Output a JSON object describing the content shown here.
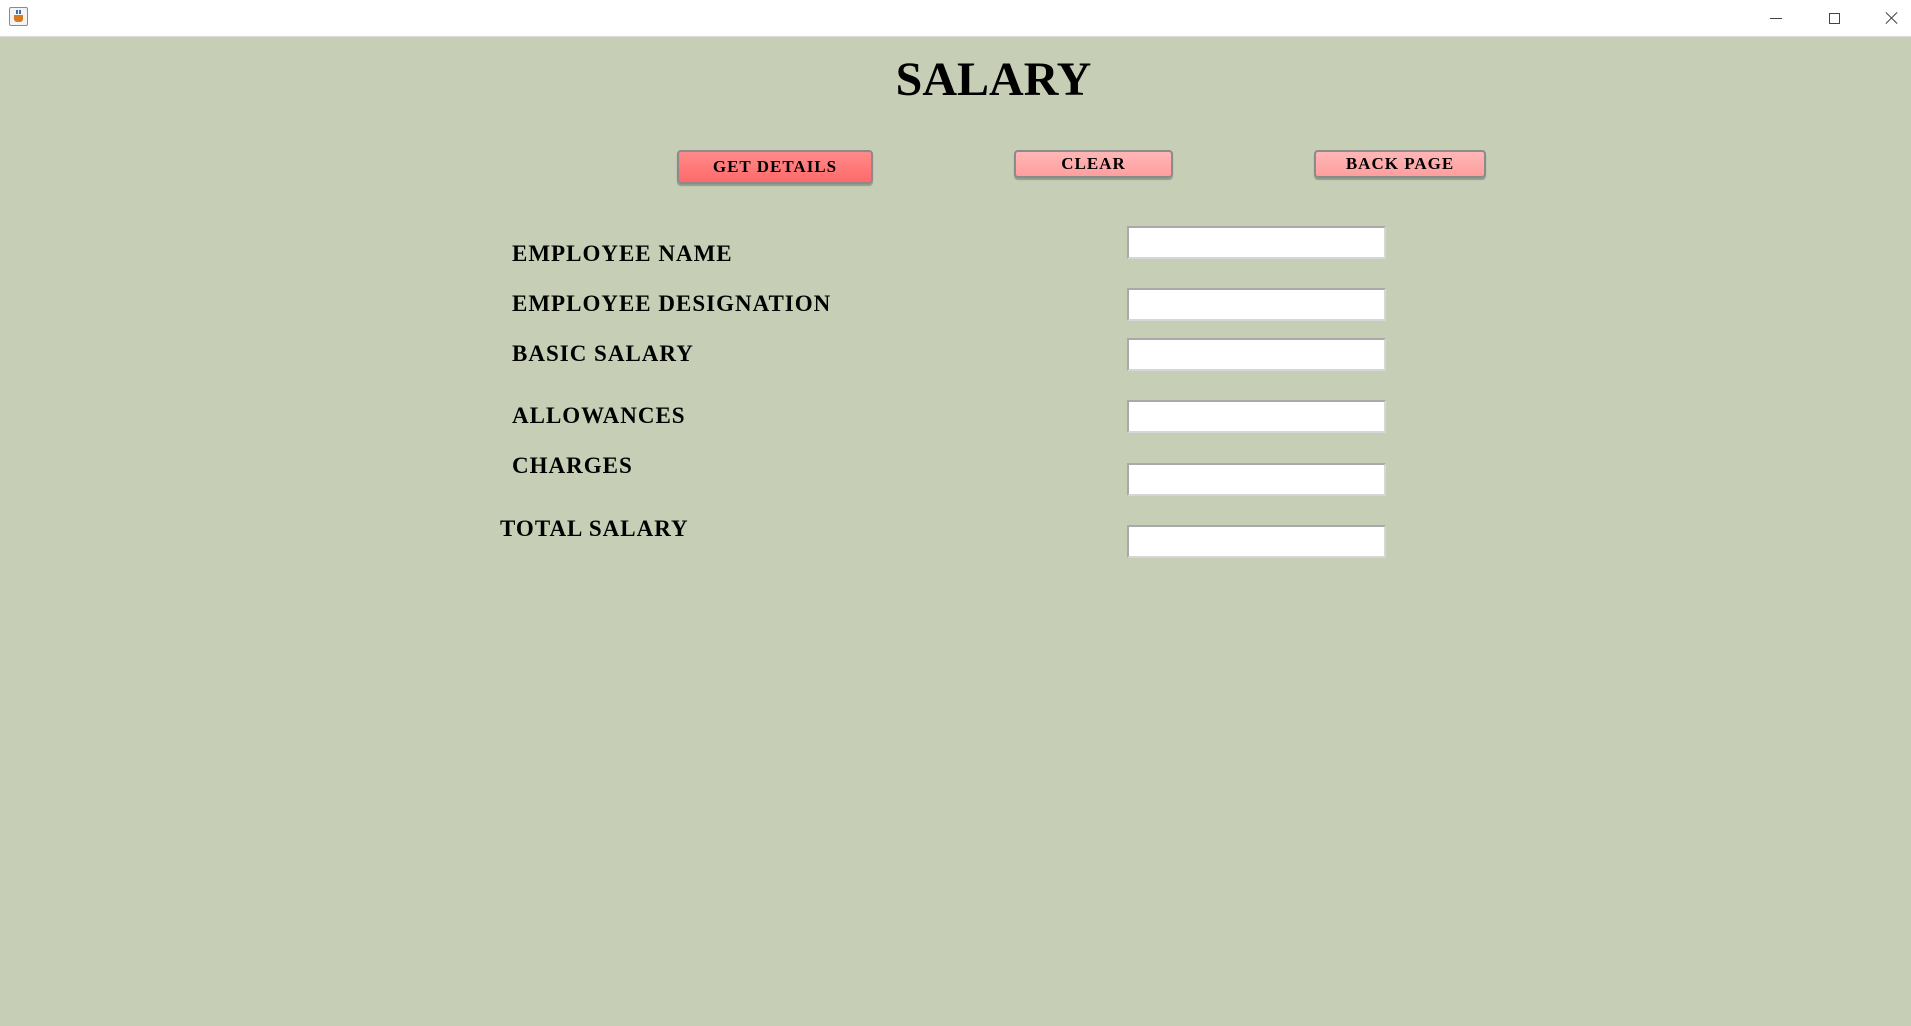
{
  "window": {
    "title": "",
    "icon": "java-cup-icon"
  },
  "page": {
    "title": "SALARY"
  },
  "buttons": {
    "get_details": "GET DETAILS",
    "clear": "CLEAR",
    "back_page": "BACK PAGE"
  },
  "form": {
    "employee_name": {
      "label": "EMPLOYEE NAME",
      "value": ""
    },
    "employee_designation": {
      "label": "EMPLOYEE DESIGNATION",
      "value": ""
    },
    "basic_salary": {
      "label": "BASIC SALARY",
      "value": ""
    },
    "allowances": {
      "label": "ALLOWANCES",
      "value": ""
    },
    "charges": {
      "label": "CHARGES",
      "value": ""
    },
    "total_salary": {
      "label": "TOTAL SALARY",
      "value": ""
    }
  },
  "colors": {
    "background": "#c6cfb6",
    "primary_button": "#ff7777",
    "secondary_button": "#ffaaaa"
  }
}
